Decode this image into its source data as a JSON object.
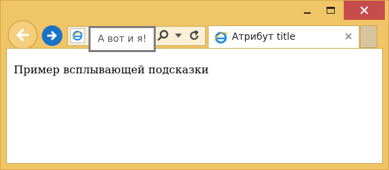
{
  "browser": {
    "tab": {
      "title": "Атрибут title"
    },
    "controls": {
      "minimize_icon": "minimize-icon",
      "maximize_icon": "maximize-icon",
      "close_icon": "close-icon",
      "back_icon": "back-arrow-icon",
      "forward_icon": "forward-arrow-icon",
      "search_icon": "search-icon",
      "refresh_icon": "refresh-icon"
    }
  },
  "page": {
    "text": "Пример всплывающей подсказки"
  },
  "tooltip": {
    "text": "А вот и я!"
  },
  "colors": {
    "frame": "#f0c566",
    "close_button": "#c74c4c",
    "forward_button": "#1a73c6",
    "tooltip_border": "#7d7d7d"
  }
}
